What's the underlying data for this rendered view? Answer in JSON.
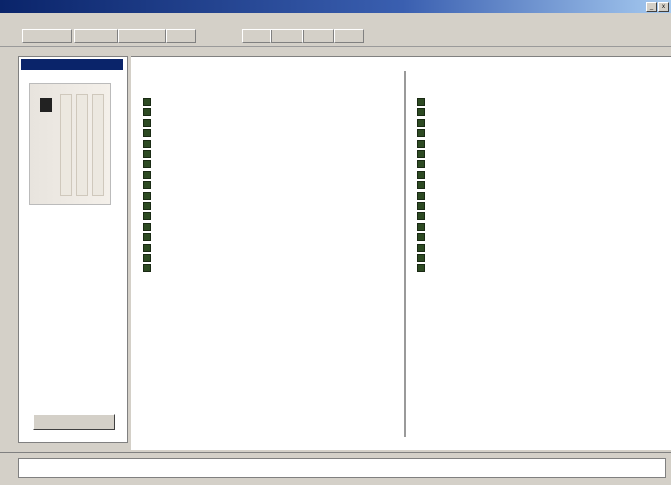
{
  "window": {
    "title": "",
    "min_label": "_",
    "close_label": "x"
  },
  "menu": {
    "items": [
      "",
      "",
      "",
      "",
      "",
      "",
      ""
    ]
  },
  "toolbar": {
    "buttons": [
      "",
      "",
      "",
      "",
      "",
      "",
      "",
      ""
    ]
  },
  "left_panel": {
    "header": "",
    "info": [
      {
        "label": "",
        "value": ""
      },
      {
        "label": "",
        "value": ""
      },
      {
        "label": "",
        "value": ""
      },
      {
        "label": "",
        "value": ""
      }
    ],
    "button_label": ""
  },
  "left_readings": [
    {
      "label": "",
      "value": ""
    },
    {
      "label": "",
      "value": ""
    },
    {
      "label": "",
      "value": ""
    },
    {
      "label": "",
      "value": ""
    },
    {
      "label": "",
      "value": ""
    },
    {
      "label": "",
      "value": ""
    },
    {
      "label": "",
      "value": ""
    },
    {
      "label": "",
      "value": ""
    },
    {
      "label": "",
      "value": ""
    },
    {
      "label": "",
      "value": ""
    },
    {
      "label": "",
      "value": ""
    },
    {
      "label": "",
      "value": ""
    },
    {
      "label": "",
      "value": ""
    },
    {
      "label": "",
      "value": ""
    },
    {
      "label": "",
      "value": ""
    },
    {
      "label": "",
      "value": ""
    },
    {
      "label": "",
      "value": ""
    }
  ],
  "right_readings": [
    {
      "label": "",
      "value": ""
    },
    {
      "label": "",
      "value": ""
    },
    {
      "label": "",
      "value": ""
    },
    {
      "label": "",
      "value": ""
    },
    {
      "label": "",
      "value": ""
    },
    {
      "label": "",
      "value": ""
    },
    {
      "label": "",
      "value": ""
    },
    {
      "label": "",
      "value": ""
    },
    {
      "label": "",
      "value": ""
    },
    {
      "label": "",
      "value": ""
    },
    {
      "label": "",
      "value": ""
    },
    {
      "label": "",
      "value": ""
    },
    {
      "label": "",
      "value": ""
    },
    {
      "label": "",
      "value": ""
    },
    {
      "label": "",
      "value": ""
    },
    {
      "label": "",
      "value": ""
    },
    {
      "label": "",
      "value": ""
    }
  ],
  "status": {
    "text": ""
  },
  "colors": {
    "title_bar": "#0a246a",
    "led": "#2d4a22",
    "panel_bg": "#d4d0c8"
  }
}
